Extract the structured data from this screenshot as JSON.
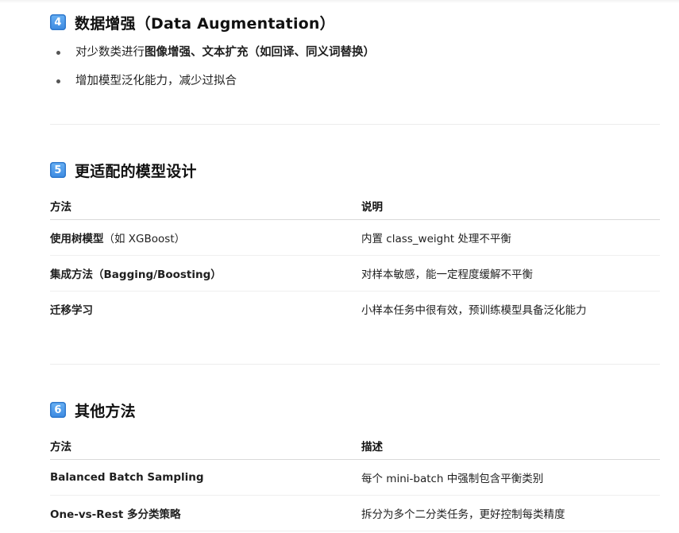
{
  "sections": {
    "augmentation": {
      "number": "4",
      "title": "数据增强（Data Augmentation）",
      "bullets": [
        {
          "prefix": "对少数类进行",
          "bold": "图像增强、文本扩充（如回译、同义词替换）",
          "suffix": ""
        },
        {
          "prefix": "增加模型泛化能力，减少过拟合",
          "bold": "",
          "suffix": ""
        }
      ]
    },
    "model_design": {
      "number": "5",
      "title": "更适配的模型设计",
      "headers": [
        "方法",
        "说明"
      ],
      "rows": [
        {
          "method": "使用树模型",
          "paren": "（如 XGBoost）",
          "desc": "内置 class_weight 处理不平衡"
        },
        {
          "method": "集成方法（Bagging/Boosting）",
          "paren": "",
          "desc": "对样本敏感，能一定程度缓解不平衡"
        },
        {
          "method": "迁移学习",
          "paren": "",
          "desc": "小样本任务中很有效，预训练模型具备泛化能力"
        }
      ]
    },
    "other_methods": {
      "number": "6",
      "title": "其他方法",
      "headers": [
        "方法",
        "描述"
      ],
      "rows": [
        {
          "method": "Balanced Batch Sampling",
          "paren": "",
          "desc": "每个 mini-batch 中强制包含平衡类别"
        },
        {
          "method": "One-vs-Rest 多分类策略",
          "paren": "",
          "desc": "拆分为多个二分类任务，更好控制每类精度"
        }
      ]
    }
  },
  "icons": {
    "keycap": "keycap-number-icon",
    "bullet": "bullet-dot-icon"
  },
  "colors": {
    "keycap": "#3b89e0",
    "text": "#1f1f1f",
    "divider": "#ececec"
  }
}
